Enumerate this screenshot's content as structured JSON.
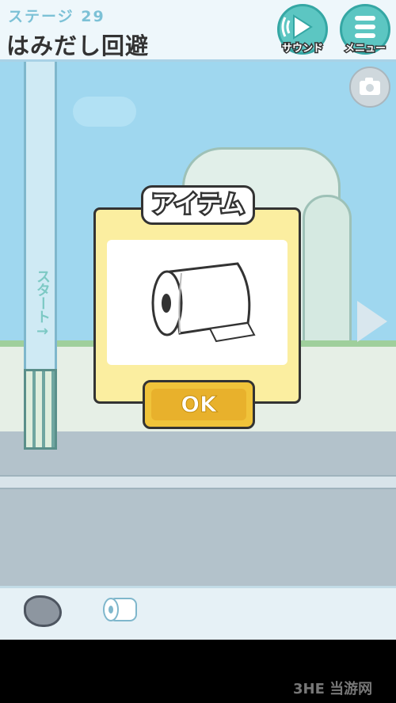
{
  "header": {
    "stage_label": "ステージ 29",
    "title": "はみだし回避"
  },
  "buttons": {
    "sound_label": "サウンド",
    "menu_label": "メニュー"
  },
  "scene": {
    "pole_sign": "スタート→"
  },
  "dialog": {
    "title": "アイテム",
    "ok_label": "OK"
  },
  "watermark": "3HE 当游网",
  "inventory": [
    {
      "icon": "rock-icon"
    },
    {
      "icon": "toilet-paper-roll-icon"
    }
  ]
}
